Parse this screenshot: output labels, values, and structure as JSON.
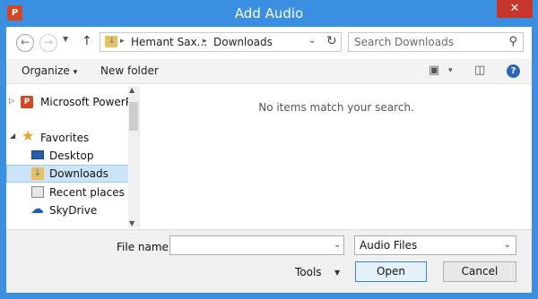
{
  "window": {
    "title": "Add Audio",
    "app_icon": "P",
    "close_glyph": "✕"
  },
  "nav": {
    "back_glyph": "←",
    "forward_glyph": "→",
    "recent_glyph": "▼",
    "up_glyph": "↑",
    "breadcrumbs": [
      "Hemant Sax...",
      "Downloads"
    ],
    "crumb_sep": "▸",
    "address_drop": "⌄",
    "refresh_glyph": "↻",
    "search_placeholder": "Search Downloads",
    "search_icon": "search-icon"
  },
  "toolbar": {
    "organize": "Organize",
    "organize_drop": "▾",
    "new_folder": "New folder",
    "view_drop": "▾",
    "help": "?"
  },
  "tree": {
    "expander_closed": "▷",
    "expander_open": "◢",
    "items": [
      {
        "label": "Microsoft PowerPc",
        "icon": "powerpoint-icon"
      },
      {
        "label": "Favorites",
        "icon": "star-icon"
      },
      {
        "label": "Desktop",
        "icon": "desktop-icon"
      },
      {
        "label": "Downloads",
        "icon": "downloads-folder-icon",
        "selected": true
      },
      {
        "label": "Recent places",
        "icon": "recent-places-icon"
      },
      {
        "label": "SkyDrive",
        "icon": "skydrive-icon"
      }
    ],
    "scroll_up": "▲",
    "scroll_down": "▼"
  },
  "content": {
    "empty_message": "No items match your search."
  },
  "bottom": {
    "file_name_label": "File name:",
    "file_name_value": "",
    "file_name_drop": "⌄",
    "file_type": "Audio Files",
    "file_type_drop": "⌄",
    "tools": "Tools",
    "tools_drop": "▼",
    "open": "Open",
    "cancel": "Cancel"
  },
  "colors": {
    "titlebar": "#3a8fe0",
    "close": "#c7362b",
    "selection": "#cce4f7",
    "primary_border": "#3b83d6"
  }
}
